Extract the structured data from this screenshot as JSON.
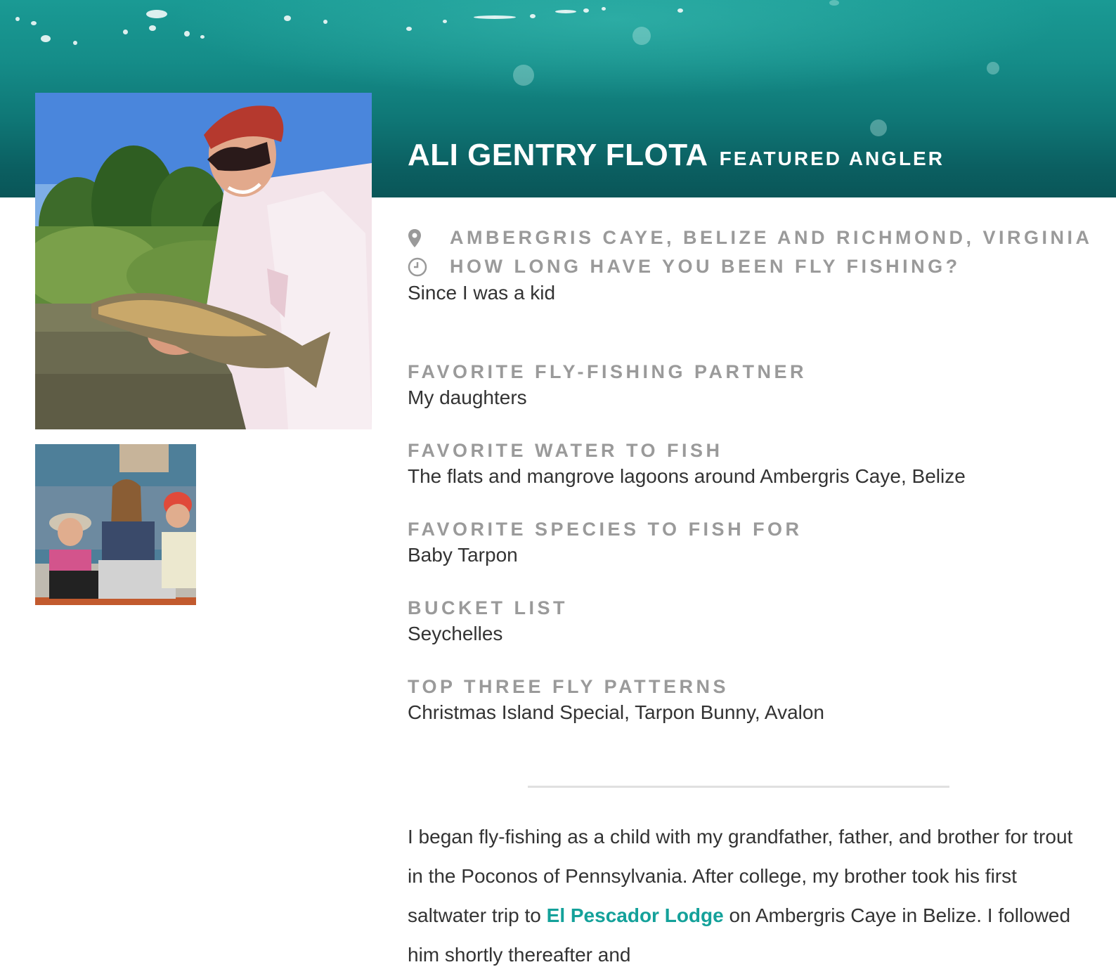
{
  "header": {
    "name": "ALI GENTRY FLOTA",
    "tag": "FEATURED ANGLER"
  },
  "photos": {
    "main_alt": "Ali Gentry Flota holding a trout",
    "thumb_alt": "Ali with her daughters in a boat"
  },
  "profile": {
    "location": "AMBERGRIS CAYE, BELIZE AND RICHMOND, VIRGINIA",
    "how_long_question": "HOW LONG HAVE YOU BEEN FLY FISHING?",
    "how_long_answer": "Since I was a kid",
    "location_icon": "map-pin-icon",
    "clock_icon": "clock-icon"
  },
  "qa": [
    {
      "q": "FAVORITE FLY-FISHING PARTNER",
      "a": "My daughters"
    },
    {
      "q": "FAVORITE WATER TO FISH",
      "a": "The flats and mangrove lagoons around Ambergris Caye, Belize"
    },
    {
      "q": "FAVORITE SPECIES TO FISH FOR",
      "a": "Baby Tarpon"
    },
    {
      "q": "BUCKET LIST",
      "a": "Seychelles"
    },
    {
      "q": "TOP THREE FLY PATTERNS",
      "a": "Christmas Island Special, Tarpon Bunny, Avalon"
    }
  ],
  "bio": {
    "part1": "I began fly-fishing as a child with my grandfather, father, and brother for trout in the Poconos of Pennsylvania.  After college, my brother took his first saltwater trip to ",
    "link": "El Pescador Lodge",
    "part2": " on Ambergris Caye in Belize. I followed him shortly thereafter and"
  },
  "colors": {
    "accent": "#14a19a",
    "label_gray": "#9a9a9a",
    "text": "#333333",
    "banner_top": "#1a9a94",
    "banner_bottom": "#0a5658"
  }
}
